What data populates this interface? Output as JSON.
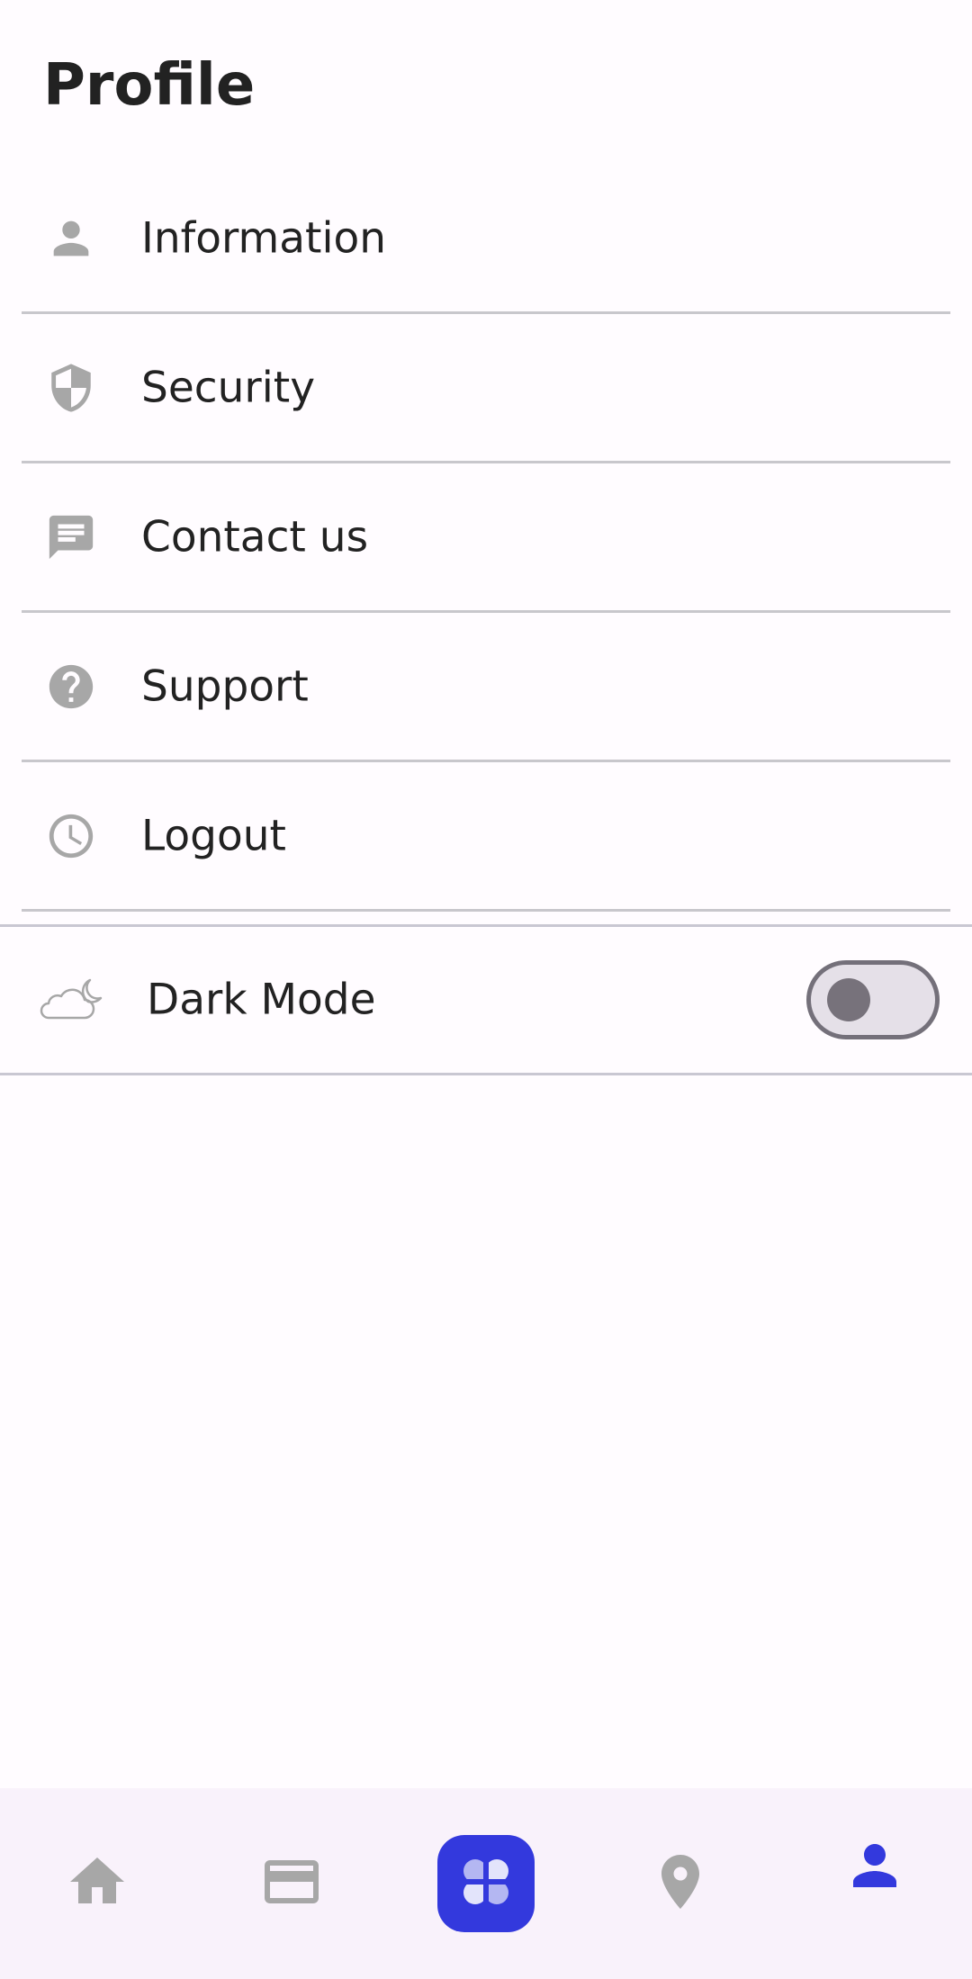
{
  "header": {
    "title": "Profile"
  },
  "menu": {
    "items": [
      {
        "label": "Information",
        "icon": "person-icon"
      },
      {
        "label": "Security",
        "icon": "shield-icon"
      },
      {
        "label": "Contact us",
        "icon": "message-icon"
      },
      {
        "label": "Support",
        "icon": "help-icon"
      },
      {
        "label": "Logout",
        "icon": "clock-icon"
      }
    ]
  },
  "dark_mode": {
    "label": "Dark Mode",
    "icon": "cloud-moon-icon",
    "enabled": false
  },
  "bottom_nav": {
    "items": [
      {
        "name": "home",
        "icon": "home-icon",
        "active": false
      },
      {
        "name": "cards",
        "icon": "credit-card-icon",
        "active": false
      },
      {
        "name": "apps",
        "icon": "clover-apps-icon",
        "active": false
      },
      {
        "name": "location",
        "icon": "location-pin-icon",
        "active": false
      },
      {
        "name": "profile",
        "icon": "person-icon",
        "active": true
      }
    ]
  },
  "colors": {
    "accent": "#3339dd",
    "icon_gray": "#a7a7a7",
    "divider": "#c8c7cc",
    "nav_background": "#f9f2fb"
  }
}
